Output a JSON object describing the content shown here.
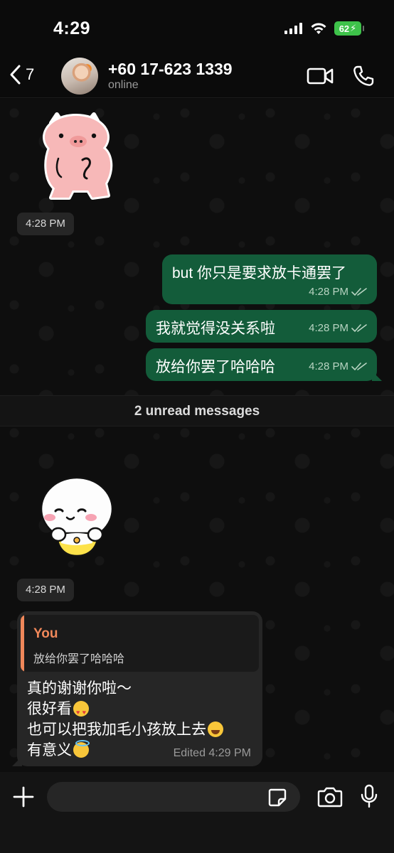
{
  "status_bar": {
    "time": "4:29",
    "battery": "62"
  },
  "header": {
    "back_count": "7",
    "contact_name": "+60 17-623 1339",
    "contact_status": "online"
  },
  "messages": {
    "sticker_time_1": "4:28 PM",
    "outgoing": [
      {
        "text": "but 你只是要求放卡通罢了",
        "time": "4:28 PM"
      },
      {
        "text": "我就觉得没关系啦",
        "time": "4:28 PM"
      },
      {
        "text": "放给你罢了哈哈哈",
        "time": "4:28 PM"
      }
    ],
    "unread_banner": "2 unread messages",
    "sticker_time_2": "4:28 PM",
    "incoming": {
      "quote_author": "You",
      "quote_text": "放给你罢了哈哈哈",
      "lines": [
        "真的谢谢你啦～",
        "很好看",
        "也可以把我加毛小孩放上去",
        "有意义"
      ],
      "meta": "Edited 4:29 PM"
    }
  },
  "composer": {
    "placeholder": ""
  },
  "colors": {
    "outgoing_bubble": "#135c3a",
    "incoming_bubble": "#262626",
    "quote_accent": "#f0885a",
    "battery": "#3ec24a"
  },
  "icons": [
    "signal-icon",
    "wifi-icon",
    "battery-icon",
    "back-chevron-icon",
    "video-call-icon",
    "phone-call-icon",
    "read-ticks-icon",
    "plus-icon",
    "sticker-icon",
    "camera-icon",
    "mic-icon"
  ]
}
